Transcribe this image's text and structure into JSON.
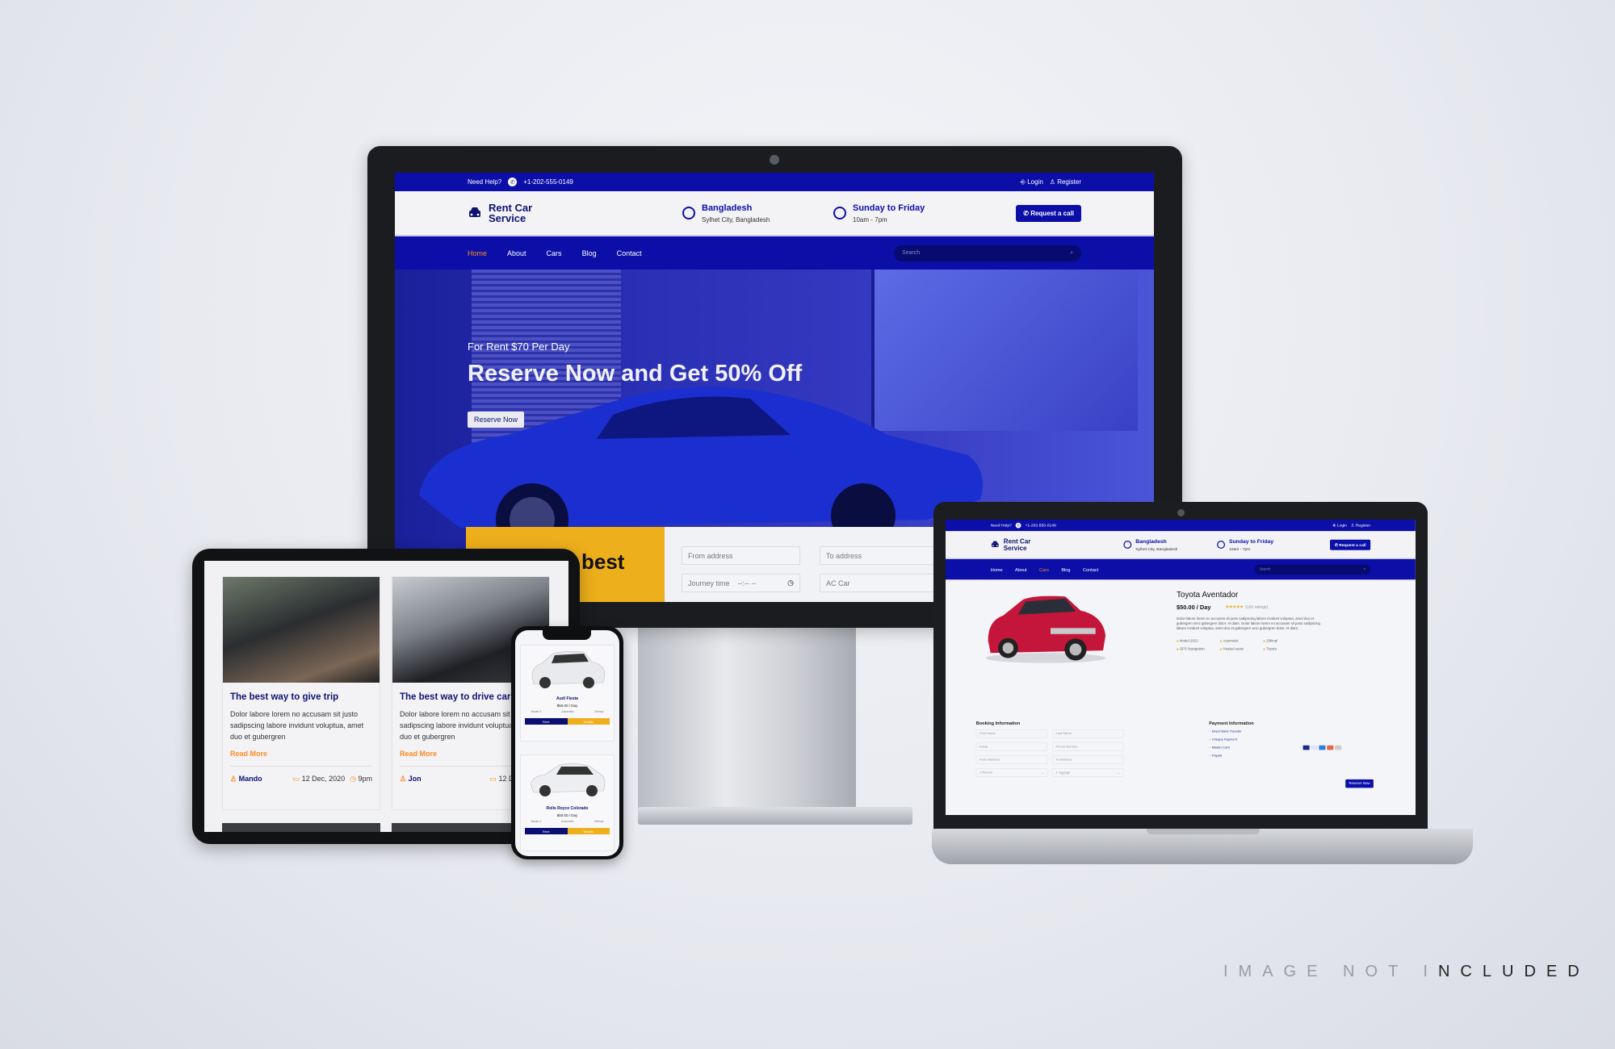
{
  "site": {
    "topbar": {
      "help": "Need Help?",
      "phone": "+1-202-555-0149",
      "login": "Login",
      "register": "Register"
    },
    "brand": {
      "line1": "Rent Car",
      "line2": "Service"
    },
    "location": {
      "title": "Bangladesh",
      "sub": "Sylhet City, Bangladesh"
    },
    "hours": {
      "title": "Sunday to Friday",
      "sub": "10am - 7pm"
    },
    "request_call": "Request a call",
    "nav": [
      "Home",
      "About",
      "Cars",
      "Blog",
      "Contact"
    ],
    "search_placeholder": "Search"
  },
  "hero": {
    "tagline": "For Rent $70 Per Day",
    "title": "Reserve Now and Get 50% Off",
    "button": "Reserve Now"
  },
  "booking_strip": {
    "heading_fragment": "best",
    "from": "From address",
    "to": "To address",
    "time": "Journey time",
    "time_value": "--:-- --",
    "car_type": "AC Car"
  },
  "product": {
    "name": "Toyota Aventador",
    "price": "$50.00 / Day",
    "stars": "★★★★★",
    "ratings": "(102 ratings)",
    "description": "Dolor labore lorem no accusam sit justo sadipscing labore invidunt voluptua, amet duo et gubergren vero gubergren dolor. At diam. Dolor labore lorem no accusam sit justo sadipscing labore invidunt voluptua, amet duo et gubergren vero gubergren dolor. At diam.",
    "features": [
      "Model-2022",
      "Automatic",
      "20kmpl",
      "GPS Navigation",
      "Heated seats",
      "Toyota"
    ],
    "booking_title": "Booking Information",
    "fields": [
      "First Name",
      "Last Name",
      "Email",
      "Phone Number",
      "From Address",
      "To Address"
    ],
    "selects": [
      "1 Person",
      "1 luggage"
    ],
    "payment_title": "Payment Information",
    "payment_options": [
      "Direct Bank Transfer",
      "Cheque Payment",
      "Master Card",
      "Paypal"
    ],
    "reserve": "Reserve Now"
  },
  "blog": [
    {
      "title": "The best way to give trip",
      "excerpt": "Dolor labore lorem no accusam sit justo sadipscing labore invidunt voluptua, amet duo et gubergren",
      "read_more": "Read More",
      "author": "Mando",
      "date": "12 Dec, 2020",
      "time": "9pm"
    },
    {
      "title": "The best way to drive cars",
      "excerpt": "Dolor labore lorem no accusam sit justo sadipscing labore invidunt voluptua, amet duo et gubergren",
      "read_more": "Read More",
      "author": "Jon",
      "date": "12 Dec, 2020"
    }
  ],
  "phone_cars": [
    {
      "name": "Audi Fiesta",
      "price": "$50.00 / Day",
      "specs": [
        "Model 3",
        "Automatic",
        "20kmpl"
      ],
      "rent": "Rent",
      "details": "Details"
    },
    {
      "name": "Rolls Royce Colorado",
      "price": "$50.00 / Day",
      "specs": [
        "Model 3",
        "Automatic",
        "20kmpl"
      ],
      "rent": "Rent",
      "details": "Details"
    }
  ],
  "watermark": {
    "grey": "IMAGE NOT I",
    "dark": "NCLUDED"
  },
  "colors": {
    "primary": "#0b0fa8",
    "accent": "#ff8a1f",
    "yellow": "#eeaf1c"
  }
}
